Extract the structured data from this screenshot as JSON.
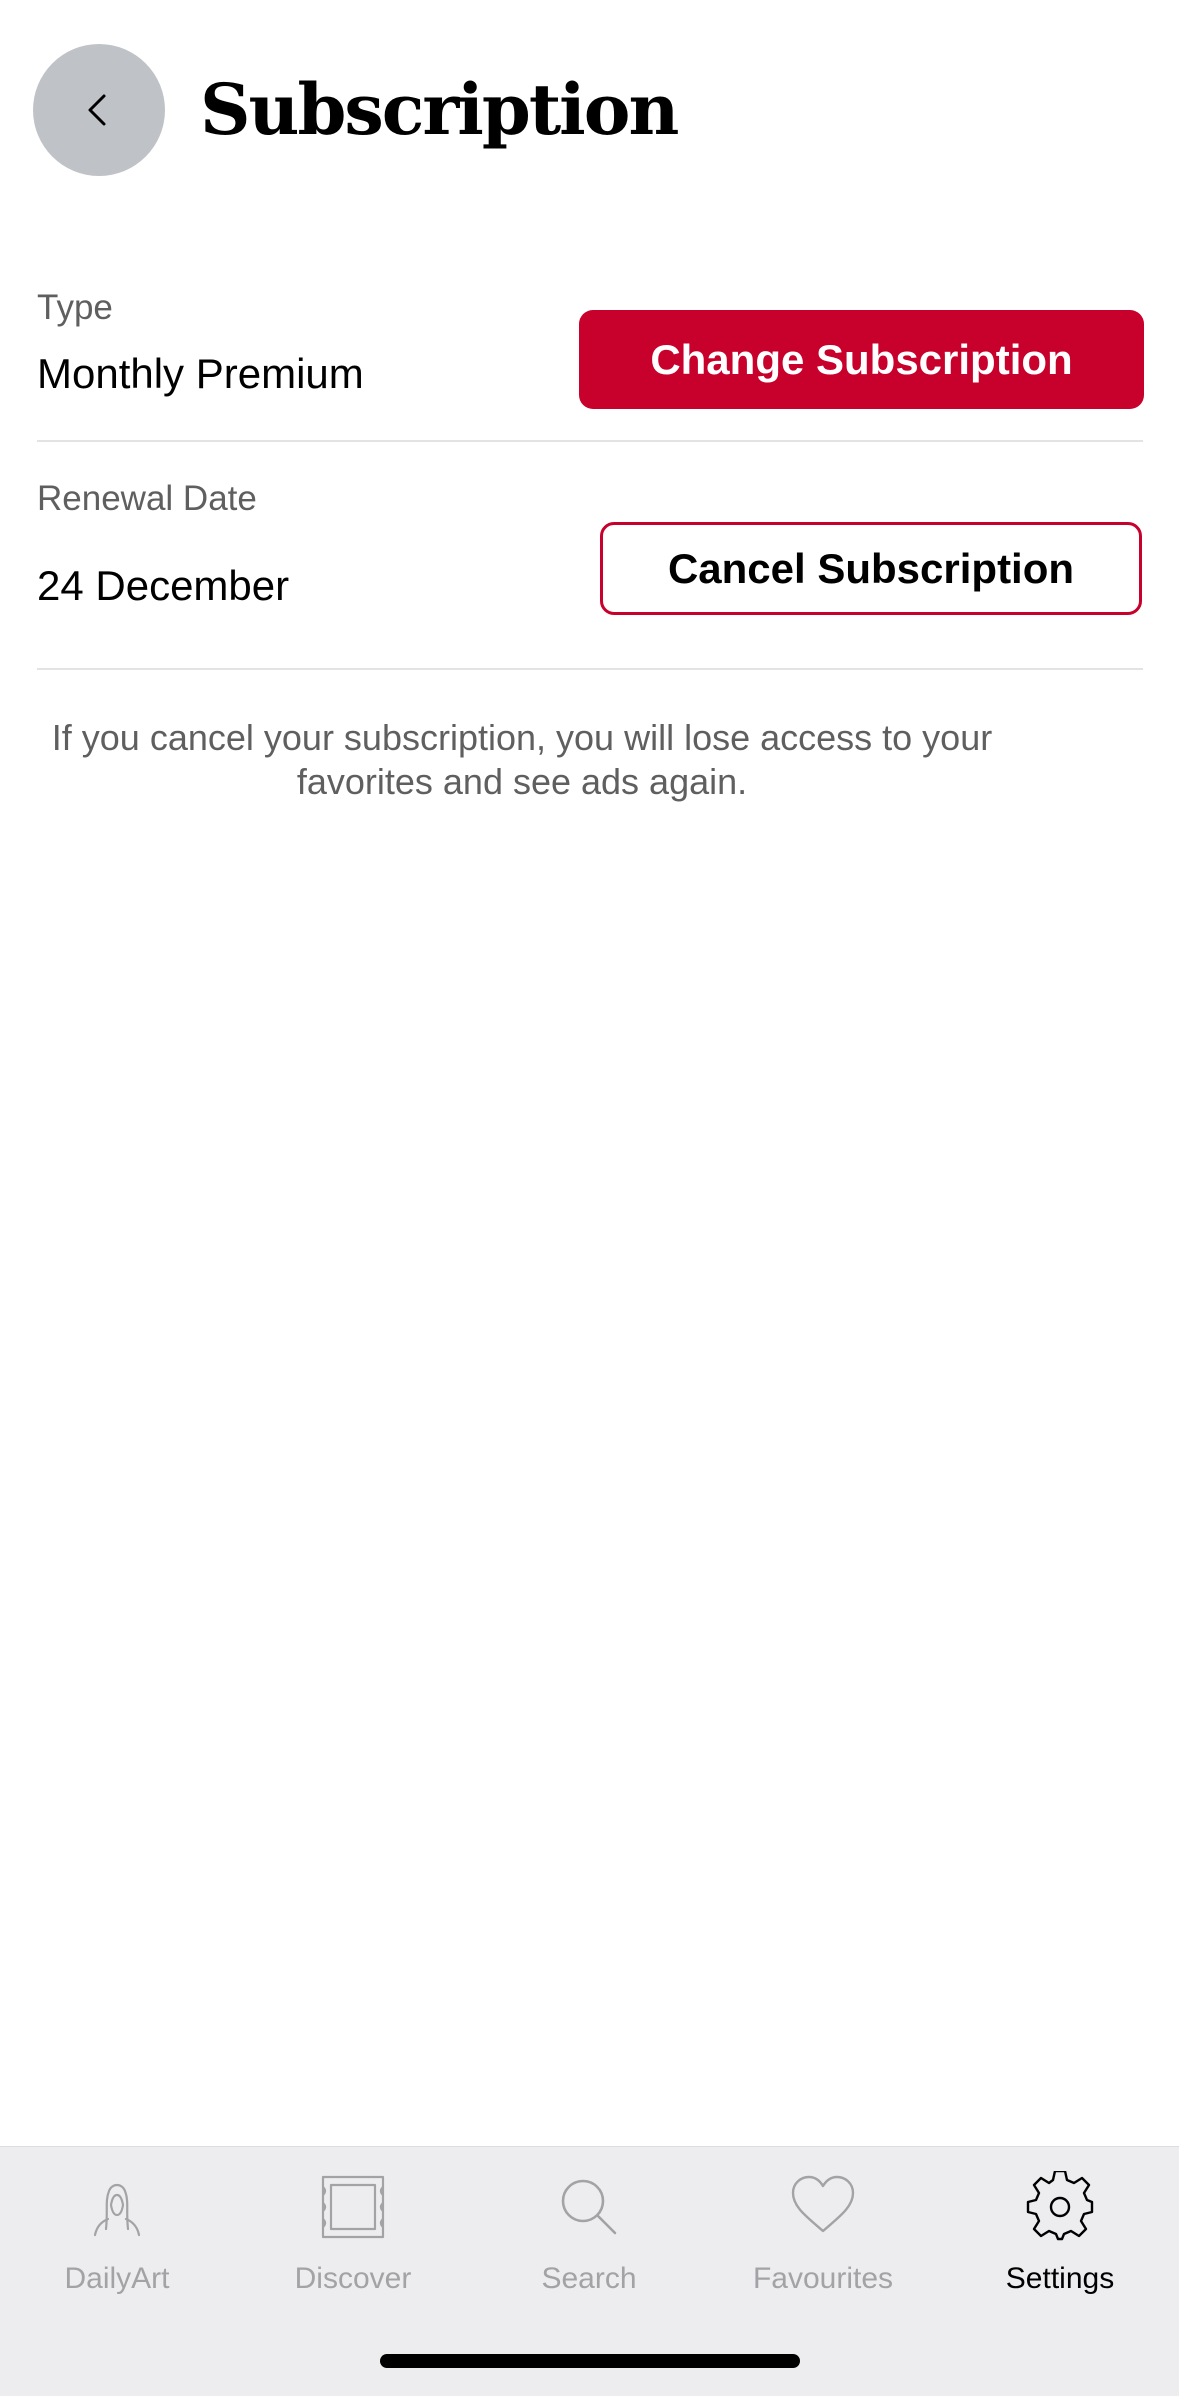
{
  "header": {
    "title": "Subscription",
    "back_icon": "chevron-left-icon"
  },
  "subscription": {
    "type_label": "Type",
    "type_value": "Monthly Premium",
    "change_button_label": "Change Subscription",
    "renewal_label": "Renewal Date",
    "renewal_value": "24 December",
    "cancel_button_label": "Cancel Subscription",
    "cancel_note": "If you cancel your subscription, you will lose access to your favorites and see ads again."
  },
  "tabbar": {
    "tabs": [
      {
        "label": "DailyArt",
        "icon": "portrait-icon",
        "active": false
      },
      {
        "label": "Discover",
        "icon": "frame-icon",
        "active": false
      },
      {
        "label": "Search",
        "icon": "search-icon",
        "active": false
      },
      {
        "label": "Favourites",
        "icon": "heart-icon",
        "active": false
      },
      {
        "label": "Settings",
        "icon": "gear-icon",
        "active": true
      }
    ]
  },
  "colors": {
    "accent": "#c8002c",
    "back_button_bg": "#bfc2c6",
    "tabbar_bg": "#ededf0",
    "inactive_tab": "#a3a3a6",
    "secondary_text": "#5f5f5f"
  }
}
